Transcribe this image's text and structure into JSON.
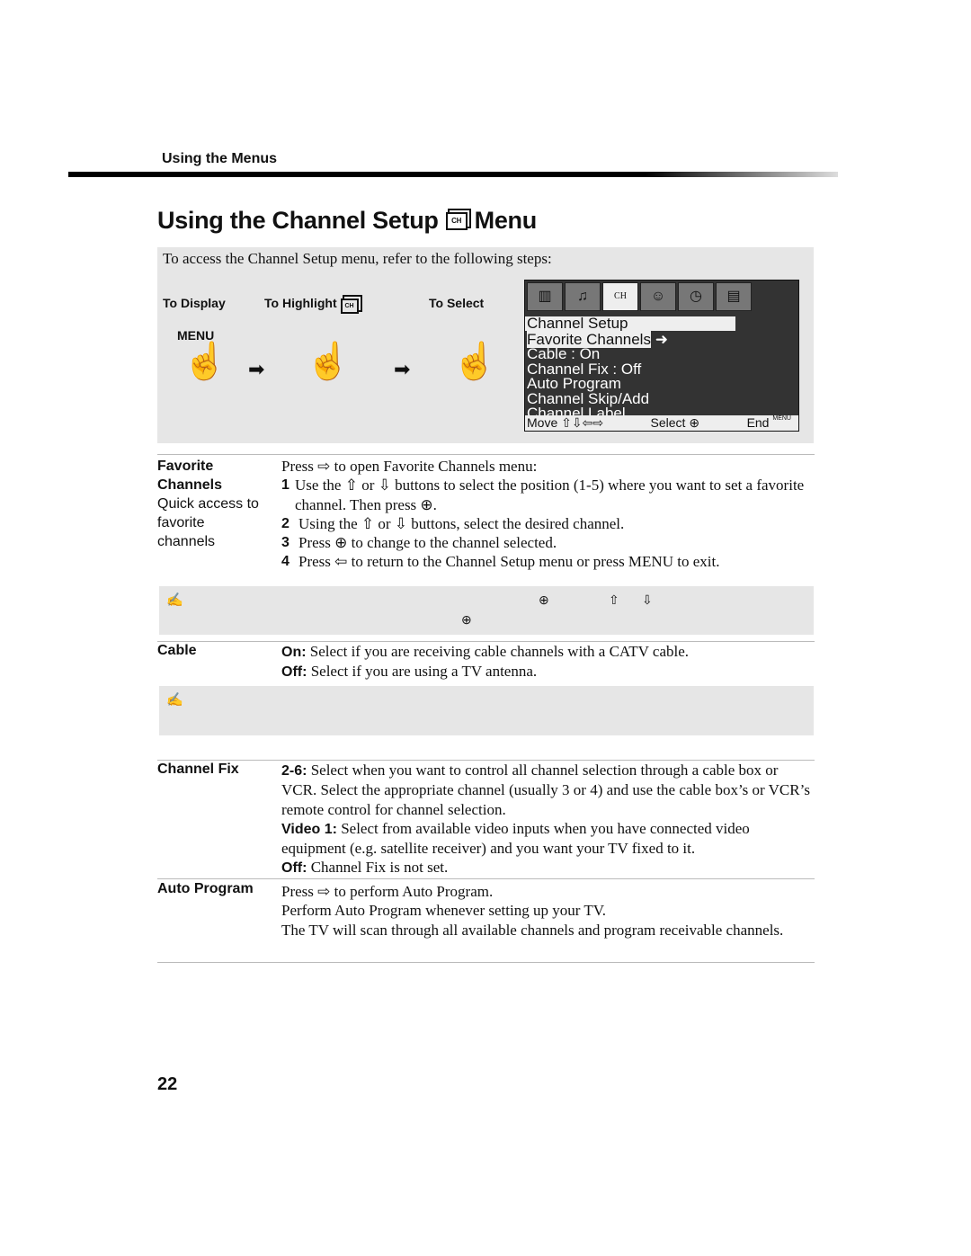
{
  "header": {
    "section": "Using the Menus",
    "title": "Using the Channel Setup",
    "title_end": "Menu",
    "title_icon": "channel-setup-icon"
  },
  "intro": "To access the Channel Setup menu, refer to the following steps:",
  "steps": {
    "display": "To Display",
    "highlight": "To Highlight",
    "select": "To Select",
    "menu_button": "MENU"
  },
  "tv_menu": {
    "heading": "Channel Setup",
    "items": [
      "Favorite Channels",
      "Cable : On",
      "Channel Fix : Off",
      "Auto Program",
      "Channel Skip/Add",
      "Channel Label"
    ],
    "footer": {
      "move": "Move",
      "select": "Select",
      "end": "End",
      "menu": "MENU"
    }
  },
  "sections": {
    "favorite": {
      "term": "Favorite Channels",
      "sub": "Quick access to favorite channels",
      "lead": "Press ⇨ to open Favorite Channels menu:",
      "steps": [
        {
          "n": "1",
          "text": "Use the ⇧ or ⇩ buttons to select the position (1-5) where you want to set a favorite channel. Then press ⊕."
        },
        {
          "n": "2",
          "text": "Using the ⇧ or ⇩ buttons, select the desired channel."
        },
        {
          "n": "3",
          "text": "Press ⊕ to change to the channel selected."
        },
        {
          "n": "4",
          "text": "Press ⇦ to return to the Channel Setup menu or press MENU to exit."
        }
      ]
    },
    "cable": {
      "term": "Cable",
      "on_label": "On:",
      "on": " Select if you are receiving cable channels with a CATV cable.",
      "off_label": "Off:",
      "off": " Select if you are using a TV antenna."
    },
    "channel_fix": {
      "term": "Channel Fix",
      "a_label": "2-6:",
      "a": " Select when you want to control all channel selection through a cable box or VCR. Select the appropriate channel (usually 3 or 4) and use the cable box’s or VCR’s remote control for channel selection.",
      "b_label": "Video 1:",
      "b": " Select from available video inputs when you have connected video equipment (e.g. satellite receiver) and you want your TV fixed to it.",
      "c_label": "Off:",
      "c": " Channel Fix is not set."
    },
    "auto_program": {
      "term": "Auto Program",
      "lines": [
        "Press ⇨ to perform Auto Program.",
        "Perform Auto Program whenever setting up your TV.",
        "The TV will scan through all available channels and program receivable channels."
      ]
    }
  },
  "page_number": "22"
}
